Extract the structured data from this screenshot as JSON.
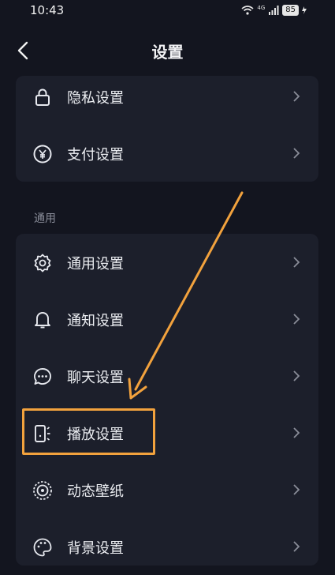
{
  "status": {
    "time": "10:43",
    "network": "4G",
    "battery": "85"
  },
  "header": {
    "title": "设置"
  },
  "card1": {
    "items": [
      {
        "label": "隐私设置",
        "icon": "lock-icon"
      },
      {
        "label": "支付设置",
        "icon": "yen-icon"
      }
    ]
  },
  "section": {
    "label": "通用"
  },
  "card2": {
    "items": [
      {
        "label": "通用设置",
        "icon": "gear-icon"
      },
      {
        "label": "通知设置",
        "icon": "bell-icon"
      },
      {
        "label": "聊天设置",
        "icon": "chat-icon"
      },
      {
        "label": "播放设置",
        "icon": "play-device-icon"
      },
      {
        "label": "动态壁纸",
        "icon": "wallpaper-icon"
      },
      {
        "label": "背景设置",
        "icon": "palette-icon"
      }
    ]
  },
  "colors": {
    "background": "#13151f",
    "card": "#1c1f2b",
    "highlight": "#f2a23d"
  }
}
